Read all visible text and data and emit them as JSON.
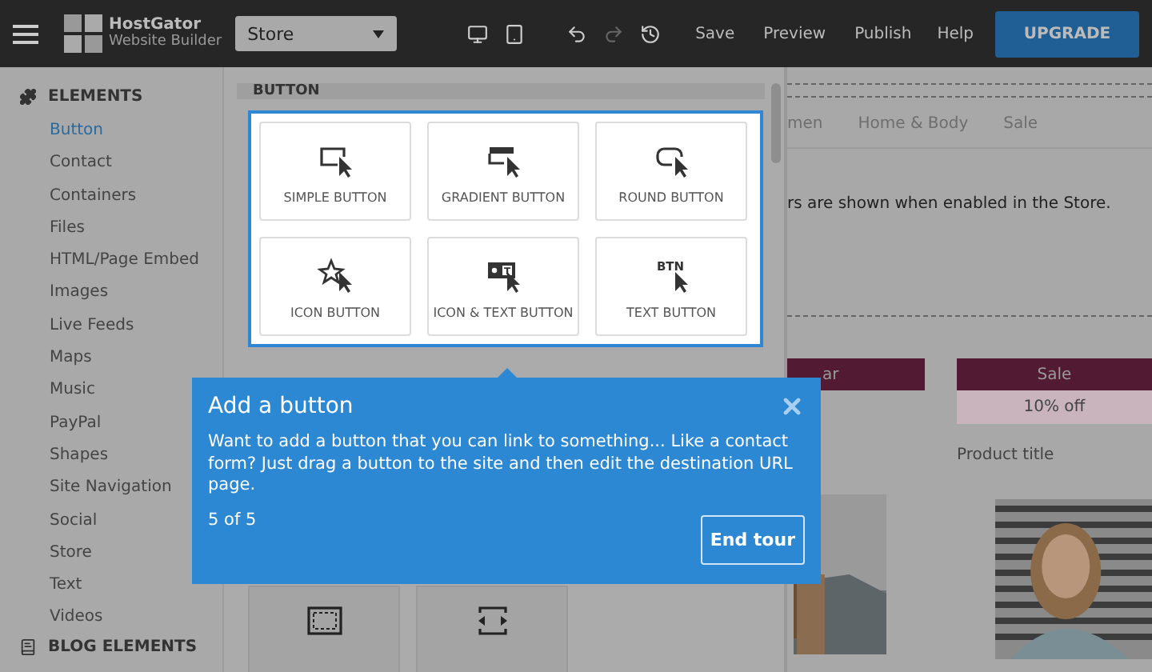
{
  "topbar": {
    "logo_line1": "HostGator",
    "logo_line2": "Website Builder",
    "page_select": "Store",
    "actions": [
      "Save",
      "Preview",
      "Publish",
      "Help"
    ],
    "upgrade": "UPGRADE"
  },
  "sidebar": {
    "elements_title": "ELEMENTS",
    "items": [
      {
        "label": "Button",
        "selected": true
      },
      {
        "label": "Contact",
        "selected": false
      },
      {
        "label": "Containers",
        "selected": false
      },
      {
        "label": "Files",
        "selected": false
      },
      {
        "label": "HTML/Page Embed",
        "selected": false
      },
      {
        "label": "Images",
        "selected": false
      },
      {
        "label": "Live Feeds",
        "selected": false
      },
      {
        "label": "Maps",
        "selected": false
      },
      {
        "label": "Music",
        "selected": false
      },
      {
        "label": "PayPal",
        "selected": false
      },
      {
        "label": "Shapes",
        "selected": false
      },
      {
        "label": "Site Navigation",
        "selected": false
      },
      {
        "label": "Social",
        "selected": false
      },
      {
        "label": "Store",
        "selected": false
      },
      {
        "label": "Text",
        "selected": false
      },
      {
        "label": "Videos",
        "selected": false
      }
    ],
    "blog_title": "BLOG ELEMENTS"
  },
  "panel": {
    "header": "BUTTON",
    "cards": [
      {
        "kind": "simple",
        "label": "SIMPLE BUTTON"
      },
      {
        "kind": "gradient",
        "label": "GRADIENT BUTTON"
      },
      {
        "kind": "round",
        "label": "ROUND BUTTON"
      },
      {
        "kind": "icon",
        "label": "ICON BUTTON"
      },
      {
        "kind": "icontext",
        "label": "ICON & TEXT BUTTON",
        "icon_text": "T"
      },
      {
        "kind": "text",
        "label": "TEXT BUTTON",
        "icon_text": "BTN"
      }
    ],
    "lower_cards": [
      {
        "kind": "frame"
      },
      {
        "kind": "stretch"
      }
    ]
  },
  "tour": {
    "title": "Add a button",
    "body": "Want to add a button that you can link to something... Like a contact form? Just drag a button to the site and then edit the destination URL page.",
    "step": "5 of 5",
    "end_button": "End tour"
  },
  "preview": {
    "nav": [
      "men",
      "Home & Body",
      "Sale"
    ],
    "notice": "rs are shown when enabled in the Store.",
    "products": [
      {
        "badge": "ar"
      },
      {
        "badge": "Sale",
        "discount": "10% off",
        "title": "Product title"
      }
    ]
  }
}
